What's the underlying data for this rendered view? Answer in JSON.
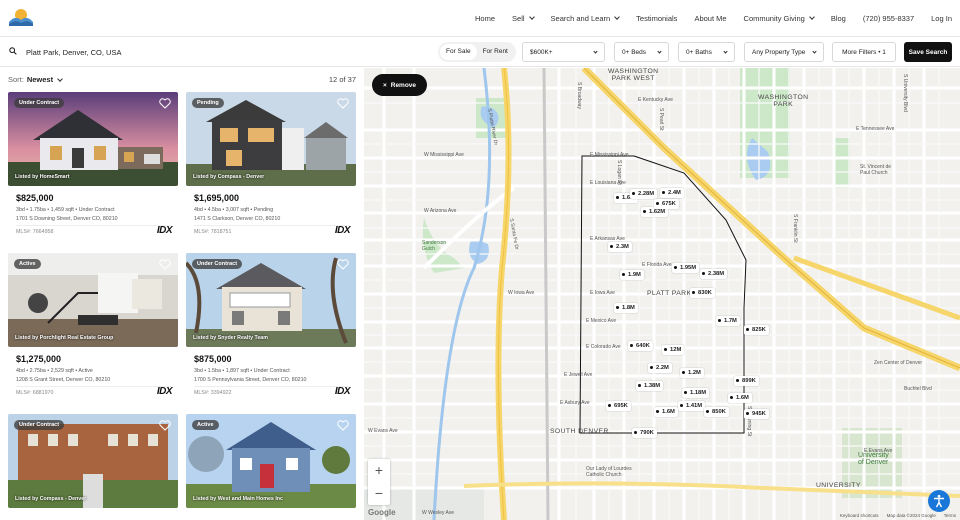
{
  "nav": {
    "items": [
      {
        "label": "Home",
        "dropdown": false
      },
      {
        "label": "Sell",
        "dropdown": true
      },
      {
        "label": "Search and Learn",
        "dropdown": true
      },
      {
        "label": "Testimonials",
        "dropdown": false
      },
      {
        "label": "About Me",
        "dropdown": false
      },
      {
        "label": "Community Giving",
        "dropdown": true
      },
      {
        "label": "Blog",
        "dropdown": false
      },
      {
        "label": "(720) 955-8337",
        "dropdown": false
      },
      {
        "label": "Log In",
        "dropdown": false
      }
    ]
  },
  "search": {
    "value": "Platt Park, Denver, CO, USA",
    "for_sale": "For Sale",
    "for_rent": "For Rent",
    "price": "$600K+",
    "beds": "0+ Beds",
    "baths": "0+ Baths",
    "property_type": "Any Property Type",
    "more_filters": "More Filters • 1",
    "save_search": "Save Search"
  },
  "list": {
    "sort_label": "Sort:",
    "sort_value": "Newest",
    "count": "12 of 37",
    "cards": [
      {
        "status": "Under Contract",
        "listed_by": "Listed by HomeSmart",
        "price": "$825,000",
        "specs": "3bd • 1.75ba • 1,459 sqft • Under Contract",
        "address": "1701 S Downing Street, Denver CO, 80210",
        "mls": "MLS#: 7664958",
        "idx": "IDX"
      },
      {
        "status": "Pending",
        "listed_by": "Listed by Compass - Denver",
        "price": "$1,695,000",
        "specs": "4bd • 4.5ba • 3,007 sqft • Pending",
        "address": "1471 S Clarkson, Denver CO, 80210",
        "mls": "MLS#: 7818751",
        "idx": "IDX"
      },
      {
        "status": "Active",
        "listed_by": "Listed by Porchlight Real Estate Group",
        "price": "$1,275,000",
        "specs": "4bd • 2.75ba • 2,529 sqft • Active",
        "address": "1208 S Grant Street, Denver CO, 80210",
        "mls": "MLS#: 6881970",
        "idx": "IDX"
      },
      {
        "status": "Under Contract",
        "listed_by": "Listed by Snyder Realty Team",
        "price": "$875,000",
        "specs": "3bd • 1.5ba • 1,897 sqft • Under Contract",
        "address": "1700 S Pennsylvania Street, Denver CO, 80210",
        "mls": "MLS#: 3394922",
        "idx": "IDX"
      },
      {
        "status": "Under Contract",
        "listed_by": "Listed by Compass - Denver"
      },
      {
        "status": "Active",
        "listed_by": "Listed by West and Main Homes Inc"
      }
    ]
  },
  "map": {
    "remove_label": "Remove",
    "pins": [
      {
        "label": "1.6M"
      },
      {
        "label": "2.28M"
      },
      {
        "label": "2.4M"
      },
      {
        "label": "1.62M"
      },
      {
        "label": "675K"
      },
      {
        "label": "2.3M"
      },
      {
        "label": "1.9M"
      },
      {
        "label": "1.95M"
      },
      {
        "label": "2.38M"
      },
      {
        "label": "1.8M"
      },
      {
        "label": "830K"
      },
      {
        "label": "1.7M"
      },
      {
        "label": "825K"
      },
      {
        "label": "640K"
      },
      {
        "label": "12M"
      },
      {
        "label": "2.2M"
      },
      {
        "label": "1.2M"
      },
      {
        "label": "1.38M"
      },
      {
        "label": "899K"
      },
      {
        "label": "1.18M"
      },
      {
        "label": "1.6M"
      },
      {
        "label": "1.41M"
      },
      {
        "label": "695K"
      },
      {
        "label": "1.6M"
      },
      {
        "label": "850K"
      },
      {
        "label": "945K"
      },
      {
        "label": "790K"
      }
    ],
    "labels": {
      "washington_park_west": "WASHINGTON\nPARK WEST",
      "washington_park": "WASHINGTON\nPARK",
      "platt_park": "PLATT PARK",
      "south_denver": "SOUTH DENVER",
      "university": "UNIVERSITY",
      "university_of_denver": "University\nof Denver",
      "sanderson_gulch": "Sanderson\nGulch",
      "st_vincent": "St. Vincent de\nPaul Church",
      "zen_center": "Zen Center of Denver",
      "our_lady": "Our Lady of Lourdes\nCatholic Church",
      "e_mississippi": "E Mississippi Ave",
      "e_tennessee": "E Tennessee Ave",
      "e_kentucky": "E Kentucky Ave",
      "e_louisiana": "E Louisiana Ave",
      "e_arkansas": "E Arkansas Ave",
      "e_florida": "E Florida Ave",
      "e_iowa": "E Iowa Ave",
      "e_mexico": "E Mexico Ave",
      "e_colorado": "E Colorado Ave",
      "e_jewell": "E Jewell Ave",
      "e_asbury": "E Asbury Ave",
      "e_evans": "E Evans Ave",
      "w_mississippi": "W Mississippi Ave",
      "w_arizona": "W Arizona Ave",
      "w_iowa": "W Iowa Ave",
      "w_evans": "W Evans Ave",
      "w_wesley": "W Wesley Ave",
      "buchtel": "Buchtel Blvd",
      "s_platte_river": "S Platte River Dr",
      "s_santa_fe": "S Santa Fe Dr",
      "s_broadway": "S Broadway",
      "s_downing": "S Downing St",
      "s_franklin": "S Franklin St",
      "s_university": "S University Blvd",
      "s_logan": "S Logan St",
      "s_pearl": "S Pearl St"
    },
    "keyboard_shortcuts": "Keyboard shortcuts",
    "map_data": "Map data ©2024 Google",
    "terms": "Terms",
    "google": "Google"
  }
}
